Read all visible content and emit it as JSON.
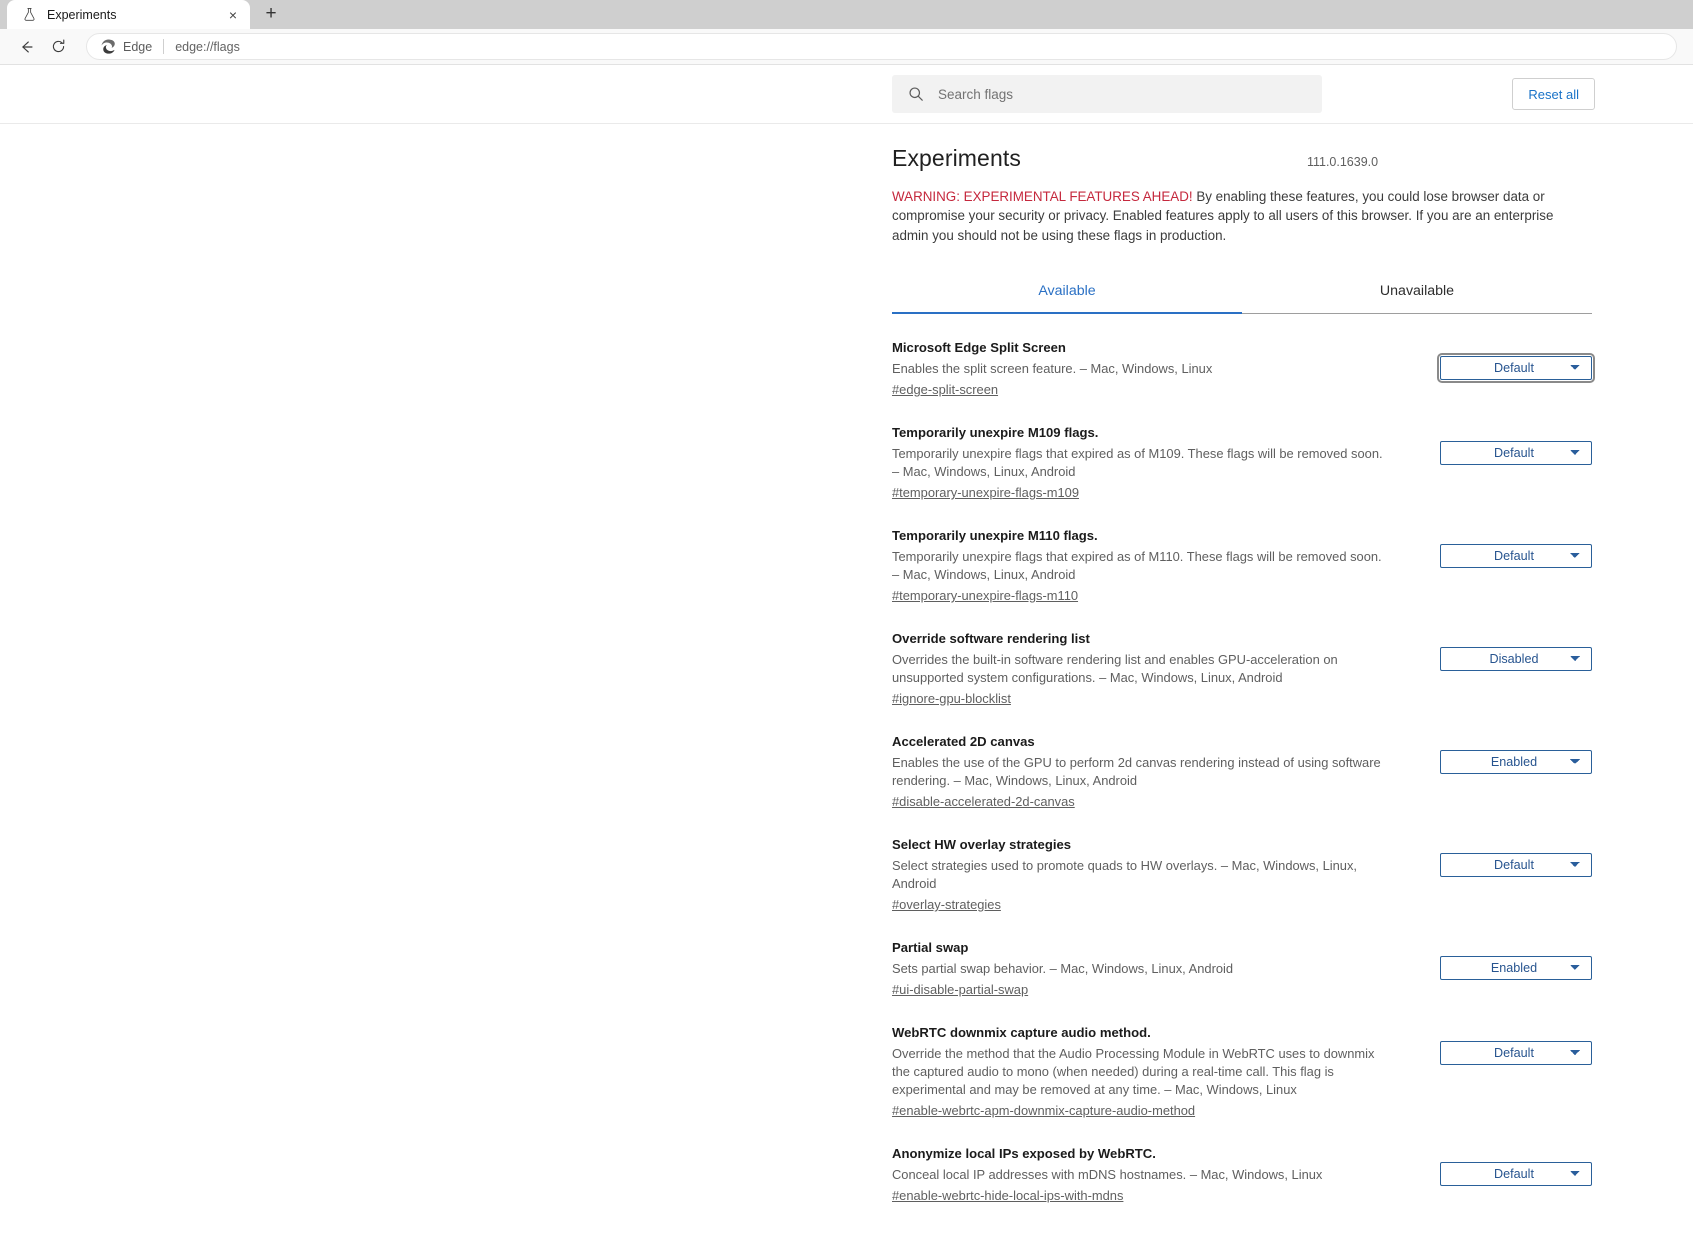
{
  "browser": {
    "tab": {
      "title": "Experiments",
      "favicon": "flask-icon",
      "close": "×"
    },
    "new_tab_label": "+",
    "toolbar": {
      "back_icon": "back-arrow-icon",
      "reload_icon": "reload-icon",
      "brand_icon": "edge-logo-icon",
      "brand_text": "Edge",
      "url": "edge://flags"
    }
  },
  "flags_page": {
    "search": {
      "placeholder": "Search flags",
      "value": "",
      "icon": "search-icon"
    },
    "reset_all_label": "Reset all",
    "title": "Experiments",
    "version": "111.0.1639.0",
    "warning": {
      "lead": "WARNING: EXPERIMENTAL FEATURES AHEAD!",
      "body": " By enabling these features, you could lose browser data or compromise your security or privacy. Enabled features apply to all users of this browser. If you are an enterprise admin you should not be using these flags in production."
    },
    "tabs": [
      {
        "label": "Available",
        "active": true
      },
      {
        "label": "Unavailable",
        "active": false
      }
    ],
    "select_options": [
      "Default",
      "Enabled",
      "Disabled"
    ],
    "flags": [
      {
        "name": "Microsoft Edge Split Screen",
        "description": "Enables the split screen feature. – Mac, Windows, Linux",
        "link": "#edge-split-screen",
        "value": "Default",
        "focused": true
      },
      {
        "name": "Temporarily unexpire M109 flags.",
        "description": "Temporarily unexpire flags that expired as of M109. These flags will be removed soon. – Mac, Windows, Linux, Android",
        "link": "#temporary-unexpire-flags-m109",
        "value": "Default",
        "focused": false
      },
      {
        "name": "Temporarily unexpire M110 flags.",
        "description": "Temporarily unexpire flags that expired as of M110. These flags will be removed soon. – Mac, Windows, Linux, Android",
        "link": "#temporary-unexpire-flags-m110",
        "value": "Default",
        "focused": false
      },
      {
        "name": "Override software rendering list",
        "description": "Overrides the built-in software rendering list and enables GPU-acceleration on unsupported system configurations. – Mac, Windows, Linux, Android",
        "link": "#ignore-gpu-blocklist",
        "value": "Disabled",
        "focused": false
      },
      {
        "name": "Accelerated 2D canvas",
        "description": "Enables the use of the GPU to perform 2d canvas rendering instead of using software rendering. – Mac, Windows, Linux, Android",
        "link": "#disable-accelerated-2d-canvas",
        "value": "Enabled",
        "focused": false
      },
      {
        "name": "Select HW overlay strategies",
        "description": "Select strategies used to promote quads to HW overlays. – Mac, Windows, Linux, Android",
        "link": "#overlay-strategies",
        "value": "Default",
        "focused": false
      },
      {
        "name": "Partial swap",
        "description": "Sets partial swap behavior. – Mac, Windows, Linux, Android",
        "link": "#ui-disable-partial-swap",
        "value": "Enabled",
        "focused": false
      },
      {
        "name": "WebRTC downmix capture audio method.",
        "description": "Override the method that the Audio Processing Module in WebRTC uses to downmix the captured audio to mono (when needed) during a real-time call. This flag is experimental and may be removed at any time. – Mac, Windows, Linux",
        "link": "#enable-webrtc-apm-downmix-capture-audio-method",
        "value": "Default",
        "focused": false
      },
      {
        "name": "Anonymize local IPs exposed by WebRTC.",
        "description": "Conceal local IP addresses with mDNS hostnames. – Mac, Windows, Linux",
        "link": "#enable-webrtc-hide-local-ips-with-mdns",
        "value": "Default",
        "focused": false
      }
    ]
  }
}
